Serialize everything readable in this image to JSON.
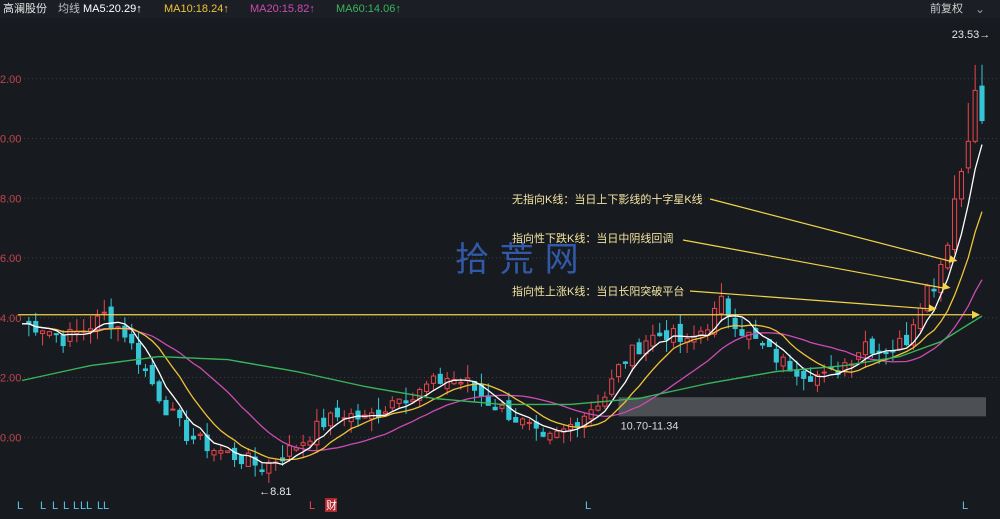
{
  "header": {
    "stock_name": "高澜股份",
    "ma_label": "均线",
    "ma5": "MA5:20.29↑",
    "ma10": "MA10:18.24↑",
    "ma20": "MA20:15.82↑",
    "ma60": "MA60:14.06↑",
    "adjust_label": "前复权"
  },
  "colors": {
    "up": "#e8454a",
    "down": "#35c6d6",
    "ma5": "#ffffff",
    "ma10": "#f0c237",
    "ma20": "#cc4bb3",
    "ma60": "#3ab45a",
    "annotation": "#f3d34a"
  },
  "chart_data": {
    "type": "candlestick",
    "y_axis_labels": [
      "2.00",
      "0.00",
      "8.00",
      "6.00",
      "4.00",
      "2.00",
      "0.00"
    ],
    "y_axis_values": [
      22,
      20,
      18,
      16,
      14,
      12,
      10
    ],
    "ylim": [
      7.9,
      23.9
    ],
    "max_price_label": "23.53",
    "min_price_label": "8.81",
    "platform_zone_label": "10.70-11.34",
    "platform_zone": [
      10.7,
      11.34
    ],
    "platform_line": 14.1,
    "annotations": [
      {
        "text": "无指向K线：当日上下影线的十字星K线"
      },
      {
        "text": "指向性下跌K线：当日中阴线回调"
      },
      {
        "text": "指向性上涨K线：当日长阳突破平台"
      }
    ],
    "watermark": "拾 荒 网",
    "bottom_markers": [
      "L",
      "L",
      "L",
      "L",
      "L",
      "L",
      "L",
      "L",
      "L",
      "L",
      "财",
      "L",
      "L"
    ],
    "ma_legend": [
      {
        "name": "MA5",
        "value": 20.29
      },
      {
        "name": "MA10",
        "value": 18.24
      },
      {
        "name": "MA20",
        "value": 15.82
      },
      {
        "name": "MA60",
        "value": 14.06
      }
    ],
    "price_path": [
      [
        0,
        13.8
      ],
      [
        3,
        13.7
      ],
      [
        6,
        13.3
      ],
      [
        9,
        13.6
      ],
      [
        11,
        13.9
      ],
      [
        12,
        14.1
      ],
      [
        15,
        13.5
      ],
      [
        18,
        12.2
      ],
      [
        21,
        11.0
      ],
      [
        24,
        10.1
      ],
      [
        28,
        9.6
      ],
      [
        32,
        9.3
      ],
      [
        35,
        9.0
      ],
      [
        38,
        9.4
      ],
      [
        41,
        9.9
      ],
      [
        44,
        10.5
      ],
      [
        47,
        10.8
      ],
      [
        50,
        10.6
      ],
      [
        53,
        11.0
      ],
      [
        55,
        11.5
      ],
      [
        57,
        11.3
      ],
      [
        59,
        11.7
      ],
      [
        62,
        12.0
      ],
      [
        65,
        11.8
      ],
      [
        68,
        11.2
      ],
      [
        71,
        10.8
      ],
      [
        74,
        10.3
      ],
      [
        76,
        9.8
      ],
      [
        79,
        10.2
      ],
      [
        82,
        10.8
      ],
      [
        85,
        11.4
      ],
      [
        87,
        12.3
      ],
      [
        88,
        12.6
      ],
      [
        91,
        13.3
      ],
      [
        94,
        13.5
      ],
      [
        97,
        13.1
      ],
      [
        100,
        13.8
      ],
      [
        102,
        14.5
      ],
      [
        105,
        13.6
      ],
      [
        108,
        13.0
      ],
      [
        111,
        12.5
      ],
      [
        114,
        12.2
      ],
      [
        117,
        12.0
      ],
      [
        119,
        12.3
      ],
      [
        121,
        12.7
      ],
      [
        123,
        13.2
      ],
      [
        125,
        12.9
      ],
      [
        127,
        13.0
      ],
      [
        129,
        13.3
      ],
      [
        131,
        14.6
      ],
      [
        133,
        15.4
      ],
      [
        134,
        15.9
      ],
      [
        135,
        16.9
      ],
      [
        136,
        18.0
      ],
      [
        137,
        19.0
      ],
      [
        138,
        20.5
      ],
      [
        139,
        21.3
      ],
      [
        140,
        20.6
      ]
    ],
    "moving_averages_end": {
      "MA5": 20.29,
      "MA10": 18.24,
      "MA20": 15.82,
      "MA60": 14.06
    },
    "ma60_path": [
      [
        0,
        11.9
      ],
      [
        10,
        12.4
      ],
      [
        20,
        12.7
      ],
      [
        30,
        12.6
      ],
      [
        40,
        12.2
      ],
      [
        50,
        11.7
      ],
      [
        60,
        11.3
      ],
      [
        70,
        11.1
      ],
      [
        80,
        11.1
      ],
      [
        90,
        11.3
      ],
      [
        100,
        11.8
      ],
      [
        110,
        12.2
      ],
      [
        120,
        12.4
      ],
      [
        128,
        12.7
      ],
      [
        134,
        13.2
      ],
      [
        140,
        14.06
      ]
    ]
  }
}
